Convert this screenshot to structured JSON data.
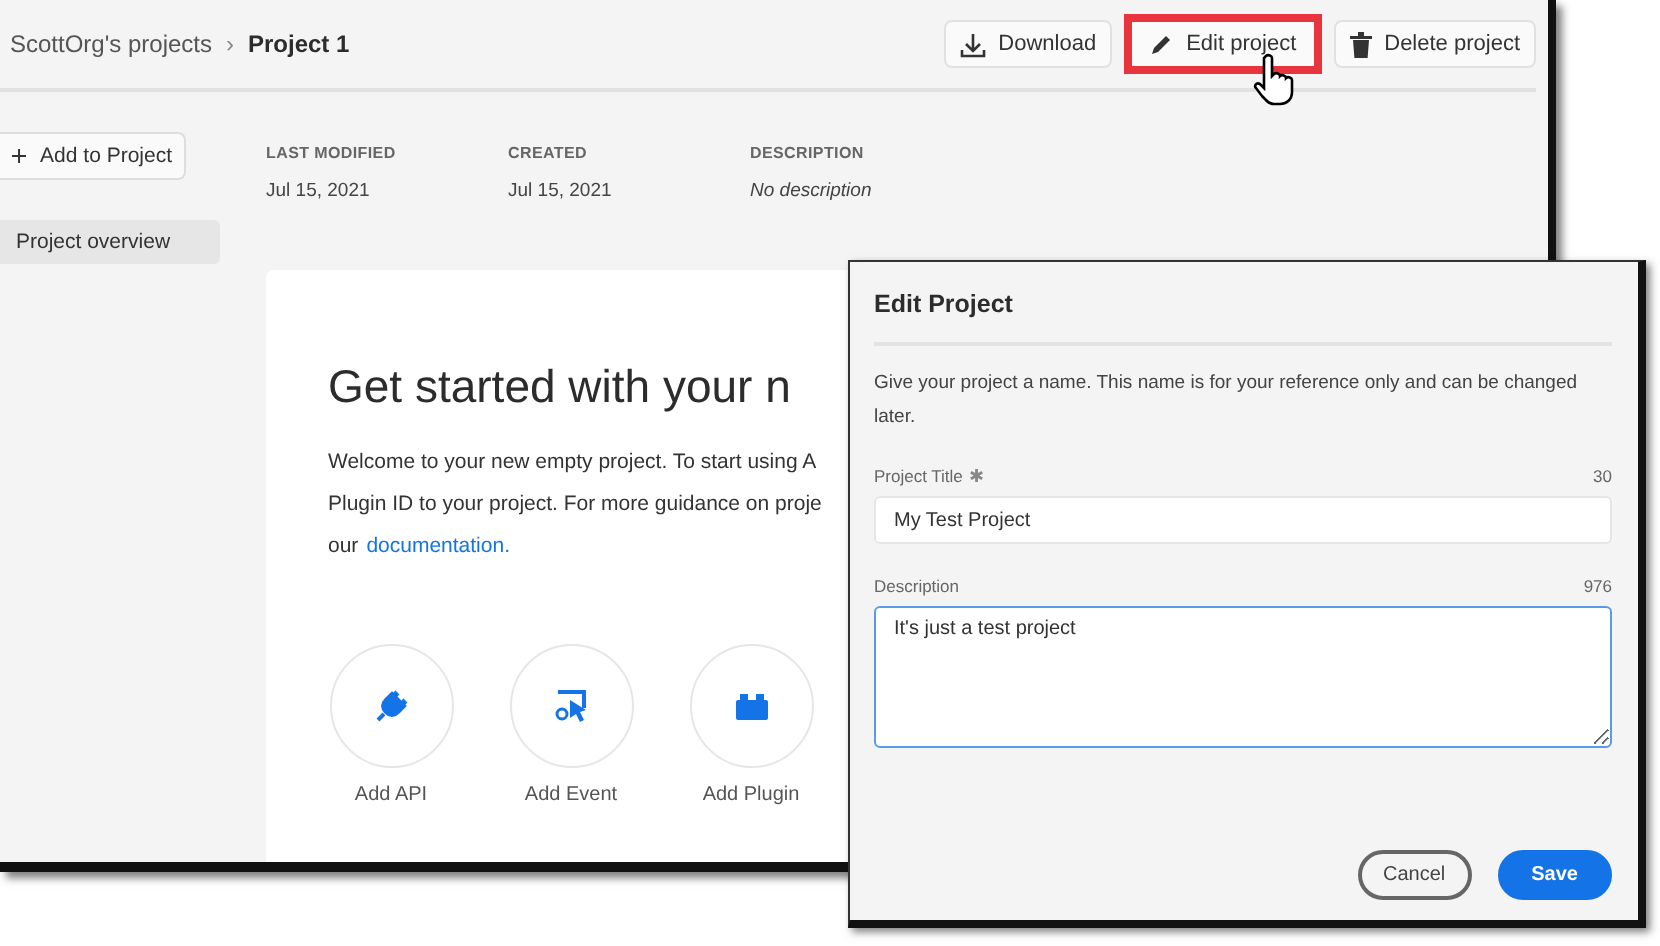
{
  "breadcrumb": [
    {
      "label": "ScottOrg's projects",
      "current": false
    },
    {
      "label": "Project 1",
      "current": true
    }
  ],
  "separator": "›",
  "actions": [
    {
      "kind": "download",
      "label": "Download",
      "highlighted": false
    },
    {
      "kind": "edit",
      "label": "Edit project",
      "highlighted": true
    },
    {
      "kind": "delete",
      "label": "Delete project",
      "highlighted": false
    }
  ],
  "sidebar": {
    "add_button": "Add to Project",
    "items": [
      {
        "label": "Project overview",
        "selected": true
      }
    ]
  },
  "meta": [
    {
      "label": "LAST MODIFIED",
      "value": "Jul 15, 2021",
      "italic": false
    },
    {
      "label": "CREATED",
      "value": "Jul 15, 2021",
      "italic": false
    },
    {
      "label": "DESCRIPTION",
      "value": "No description",
      "italic": true
    }
  ],
  "card": {
    "heading": "Get started with your n",
    "lines": [
      "Welcome to your new empty project. To start using A",
      "Plugin ID to your project. For more guidance on proje"
    ],
    "last_line_prefix": "our",
    "link": "documentation.",
    "tiles": [
      {
        "kind": "api",
        "label": "Add API"
      },
      {
        "kind": "event",
        "label": "Add Event"
      },
      {
        "kind": "plugin",
        "label": "Add Plugin"
      }
    ]
  },
  "dialog": {
    "title": "Edit Project",
    "intro": "Give your project a name. This name is for your reference only and can be changed later.",
    "fields": [
      {
        "kind": "input",
        "label": "Project Title",
        "required_mark": "✱",
        "counter": "30",
        "value": "My Test Project",
        "focused": false
      },
      {
        "kind": "textarea",
        "label": "Description",
        "counter": "976",
        "value": "It's just a test project",
        "focused": true
      }
    ],
    "buttons": [
      {
        "kind": "secondary",
        "label": "Cancel"
      },
      {
        "kind": "primary",
        "label": "Save"
      }
    ]
  }
}
